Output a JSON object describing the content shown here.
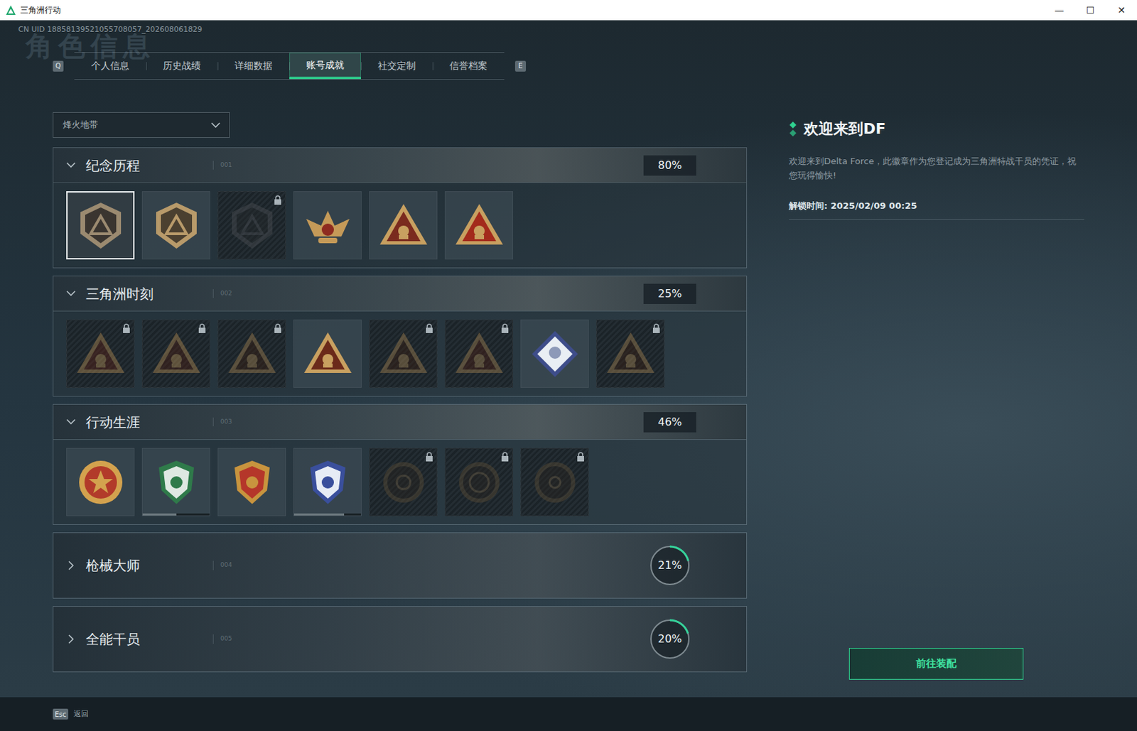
{
  "window": {
    "title": "三角洲行动",
    "controls": [
      "—",
      "☐",
      "✕"
    ]
  },
  "uid": "CN UID 18858139521055708057_202608061829",
  "watermark": "角色信息",
  "tabs": {
    "prev_key": "Q",
    "next_key": "E",
    "items": [
      {
        "label": "个人信息",
        "selected": false
      },
      {
        "label": "历史战绩",
        "selected": false
      },
      {
        "label": "详细数据",
        "selected": false
      },
      {
        "label": "账号成就",
        "selected": true
      },
      {
        "label": "社交定制",
        "selected": false
      },
      {
        "label": "信誉档案",
        "selected": false
      }
    ]
  },
  "mode_select": {
    "value": "烽火地带",
    "expanded": false
  },
  "sections": [
    {
      "title": "纪念历程",
      "number": "001",
      "percent": "80%",
      "expanded": true,
      "badges": [
        {
          "locked": false,
          "selected": true
        },
        {
          "locked": false,
          "selected": false
        },
        {
          "locked": true,
          "selected": false
        },
        {
          "locked": false,
          "selected": false
        },
        {
          "locked": false,
          "selected": false
        },
        {
          "locked": false,
          "selected": false
        }
      ]
    },
    {
      "title": "三角洲时刻",
      "number": "002",
      "percent": "25%",
      "expanded": true,
      "badges": [
        {
          "locked": true,
          "selected": false
        },
        {
          "locked": true,
          "selected": false
        },
        {
          "locked": true,
          "selected": false
        },
        {
          "locked": false,
          "selected": false
        },
        {
          "locked": true,
          "selected": false
        },
        {
          "locked": true,
          "selected": false
        },
        {
          "locked": false,
          "selected": false
        },
        {
          "locked": true,
          "selected": false
        }
      ]
    },
    {
      "title": "行动生涯",
      "number": "003",
      "percent": "46%",
      "expanded": true,
      "badges": [
        {
          "locked": false,
          "selected": false
        },
        {
          "locked": false,
          "selected": false,
          "level": 0.5
        },
        {
          "locked": false,
          "selected": false
        },
        {
          "locked": false,
          "selected": false,
          "level": 0.75
        },
        {
          "locked": true,
          "selected": false
        },
        {
          "locked": true,
          "selected": false
        },
        {
          "locked": true,
          "selected": false
        }
      ]
    },
    {
      "title": "枪械大师",
      "number": "004",
      "percent": "21%",
      "expanded": false,
      "level": 0.21,
      "badges": []
    },
    {
      "title": "全能干员",
      "number": "005",
      "percent": "20%",
      "expanded": false,
      "level": 0.2,
      "badges": []
    }
  ],
  "detail": {
    "title": "欢迎来到DF",
    "description": "欢迎来到Delta Force，此徽章作为您登记成为三角洲特战干员的凭证，祝您玩得愉快!",
    "unlock_label": "解锁时间:",
    "unlock_time": "2025/02/09 00:25",
    "button": "前往装配"
  },
  "footer": {
    "key": "Esc",
    "label": "返回"
  }
}
